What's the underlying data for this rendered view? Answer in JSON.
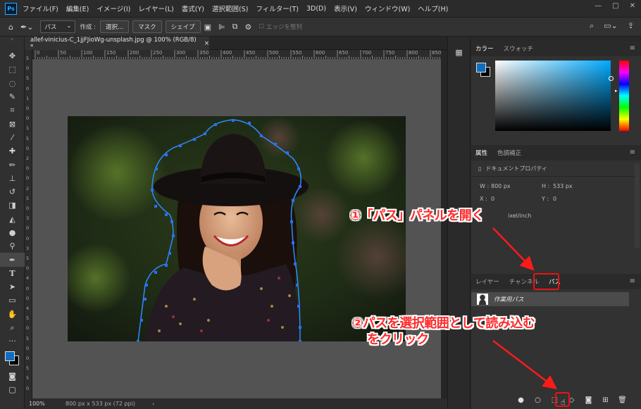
{
  "app": {
    "logo": "Ps"
  },
  "menu": [
    "ファイル(F)",
    "編集(E)",
    "イメージ(I)",
    "レイヤー(L)",
    "書式(Y)",
    "選択範囲(S)",
    "フィルター(T)",
    "3D(D)",
    "表示(V)",
    "ウィンドウ(W)",
    "ヘルプ(H)"
  ],
  "window_controls": [
    "—",
    "□",
    "✕"
  ],
  "options": {
    "mode_select": "パス",
    "create_label": "作成 :",
    "selection_btn": "選択...",
    "mask_btn": "マスク",
    "shape_btn": "シェイプ",
    "align_edges": "エッジを整列"
  },
  "document": {
    "tab_title": "allef-vinicius-C_1jjFJioWg-unsplash.jpg @ 100% (RGB/8) *",
    "close": "×",
    "zoom": "100%",
    "doc_info": "800 px x 533 px (72 ppi)",
    "status_arrow": "›"
  },
  "ruler_top": [
    "0",
    "50",
    "100",
    "150",
    "200",
    "250",
    "300",
    "350",
    "400",
    "450",
    "500",
    "550",
    "600",
    "650",
    "700",
    "750",
    "800",
    "850"
  ],
  "ruler_left": [
    "5",
    "0",
    "5",
    "0",
    "1",
    "0",
    "0",
    "1",
    "5",
    "0",
    "2",
    "0",
    "0",
    "2",
    "5",
    "0",
    "3",
    "0",
    "0",
    "3",
    "5",
    "0",
    "4",
    "0",
    "0",
    "4",
    "5",
    "0",
    "5",
    "0",
    "0",
    "5",
    "5",
    "0"
  ],
  "color_panel": {
    "tabs": [
      "カラー",
      "スウォッチ"
    ],
    "active": 0,
    "hue_color": "#00aaff"
  },
  "properties_panel": {
    "tabs": [
      "属性",
      "色調補正"
    ],
    "doc_props": "ドキュメントプロパティ",
    "w_label": "W :",
    "w_value": "800 px",
    "h_label": "H :",
    "h_value": "533 px",
    "x_label": "X :",
    "x_value": "0",
    "y_label": "Y :",
    "y_value": "0",
    "resolution": "ixel/inch"
  },
  "paths_panel": {
    "tabs": [
      "レイヤー",
      "チャンネル",
      "パス"
    ],
    "active": 2,
    "path_name": "作業用パス"
  },
  "annotations": {
    "step1": "①「パス」パネルを開く",
    "step2_line1": "②パスを選択範囲として読み込む",
    "step2_line2": "をクリック"
  }
}
